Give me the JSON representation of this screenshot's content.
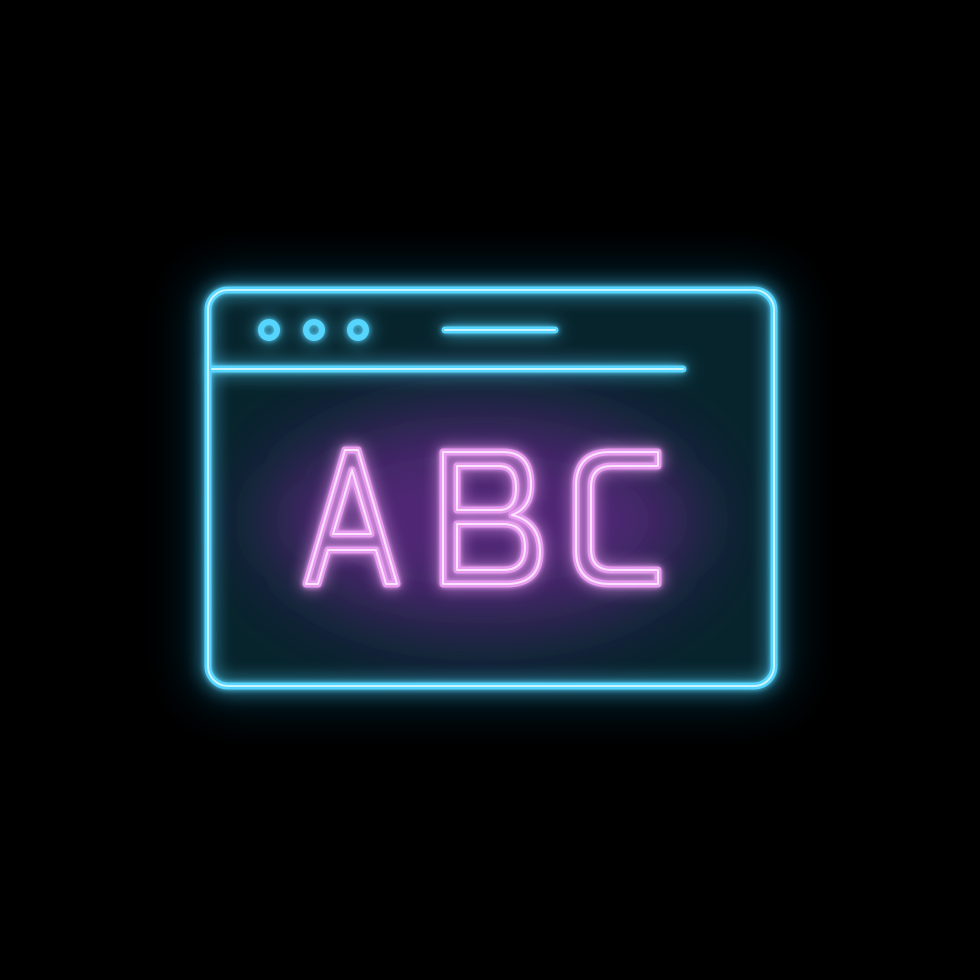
{
  "illustration": {
    "subject": "browser-window-icon",
    "style": "neon",
    "content_text": "ABC",
    "colors": {
      "background": "#000000",
      "frame_neon": "#56d6ff",
      "frame_core": "#c8f4ff",
      "frame_glow": "#1aa8e6",
      "interior_tint": "#07262e",
      "text_neon": "#e79cf0",
      "text_core": "#fbe3ff",
      "text_glow": "#8a2bb0"
    },
    "window_controls": {
      "dots": [
        "dot",
        "dot",
        "dot"
      ],
      "title_bar_pill": "address-bar"
    }
  }
}
